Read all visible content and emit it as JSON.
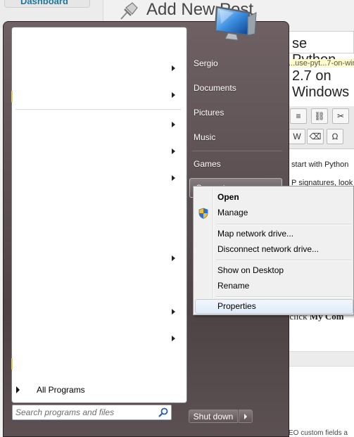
{
  "background": {
    "sidebar_item": "Dashboard",
    "page_title": "Add New Post",
    "post_title": "se Python 2.7 on Windows",
    "permalink_slug": "...use-pyt...7-on-wir",
    "text_line1": "start with Python",
    "text_line2": "P signatures, look",
    "text_line3_prefix": "ht click ",
    "text_line3_bold": "My Com",
    "footer_text": "EO custom fields a"
  },
  "start_menu": {
    "all_programs_label": "All Programs",
    "search_placeholder": "Search programs and files",
    "right_items": [
      "Sergio",
      "Documents",
      "Pictures",
      "Music",
      "Games"
    ],
    "computer_label": "Computer",
    "shutdown_label": "Shut down"
  },
  "context_menu": {
    "items": [
      "Open",
      "Manage",
      "Map network drive...",
      "Disconnect network drive...",
      "Show on Desktop",
      "Rename",
      "Properties"
    ]
  },
  "colors": {
    "menu_frame": "#5e5254",
    "hover_border": "#aecff7",
    "link_blue": "#21759b"
  }
}
